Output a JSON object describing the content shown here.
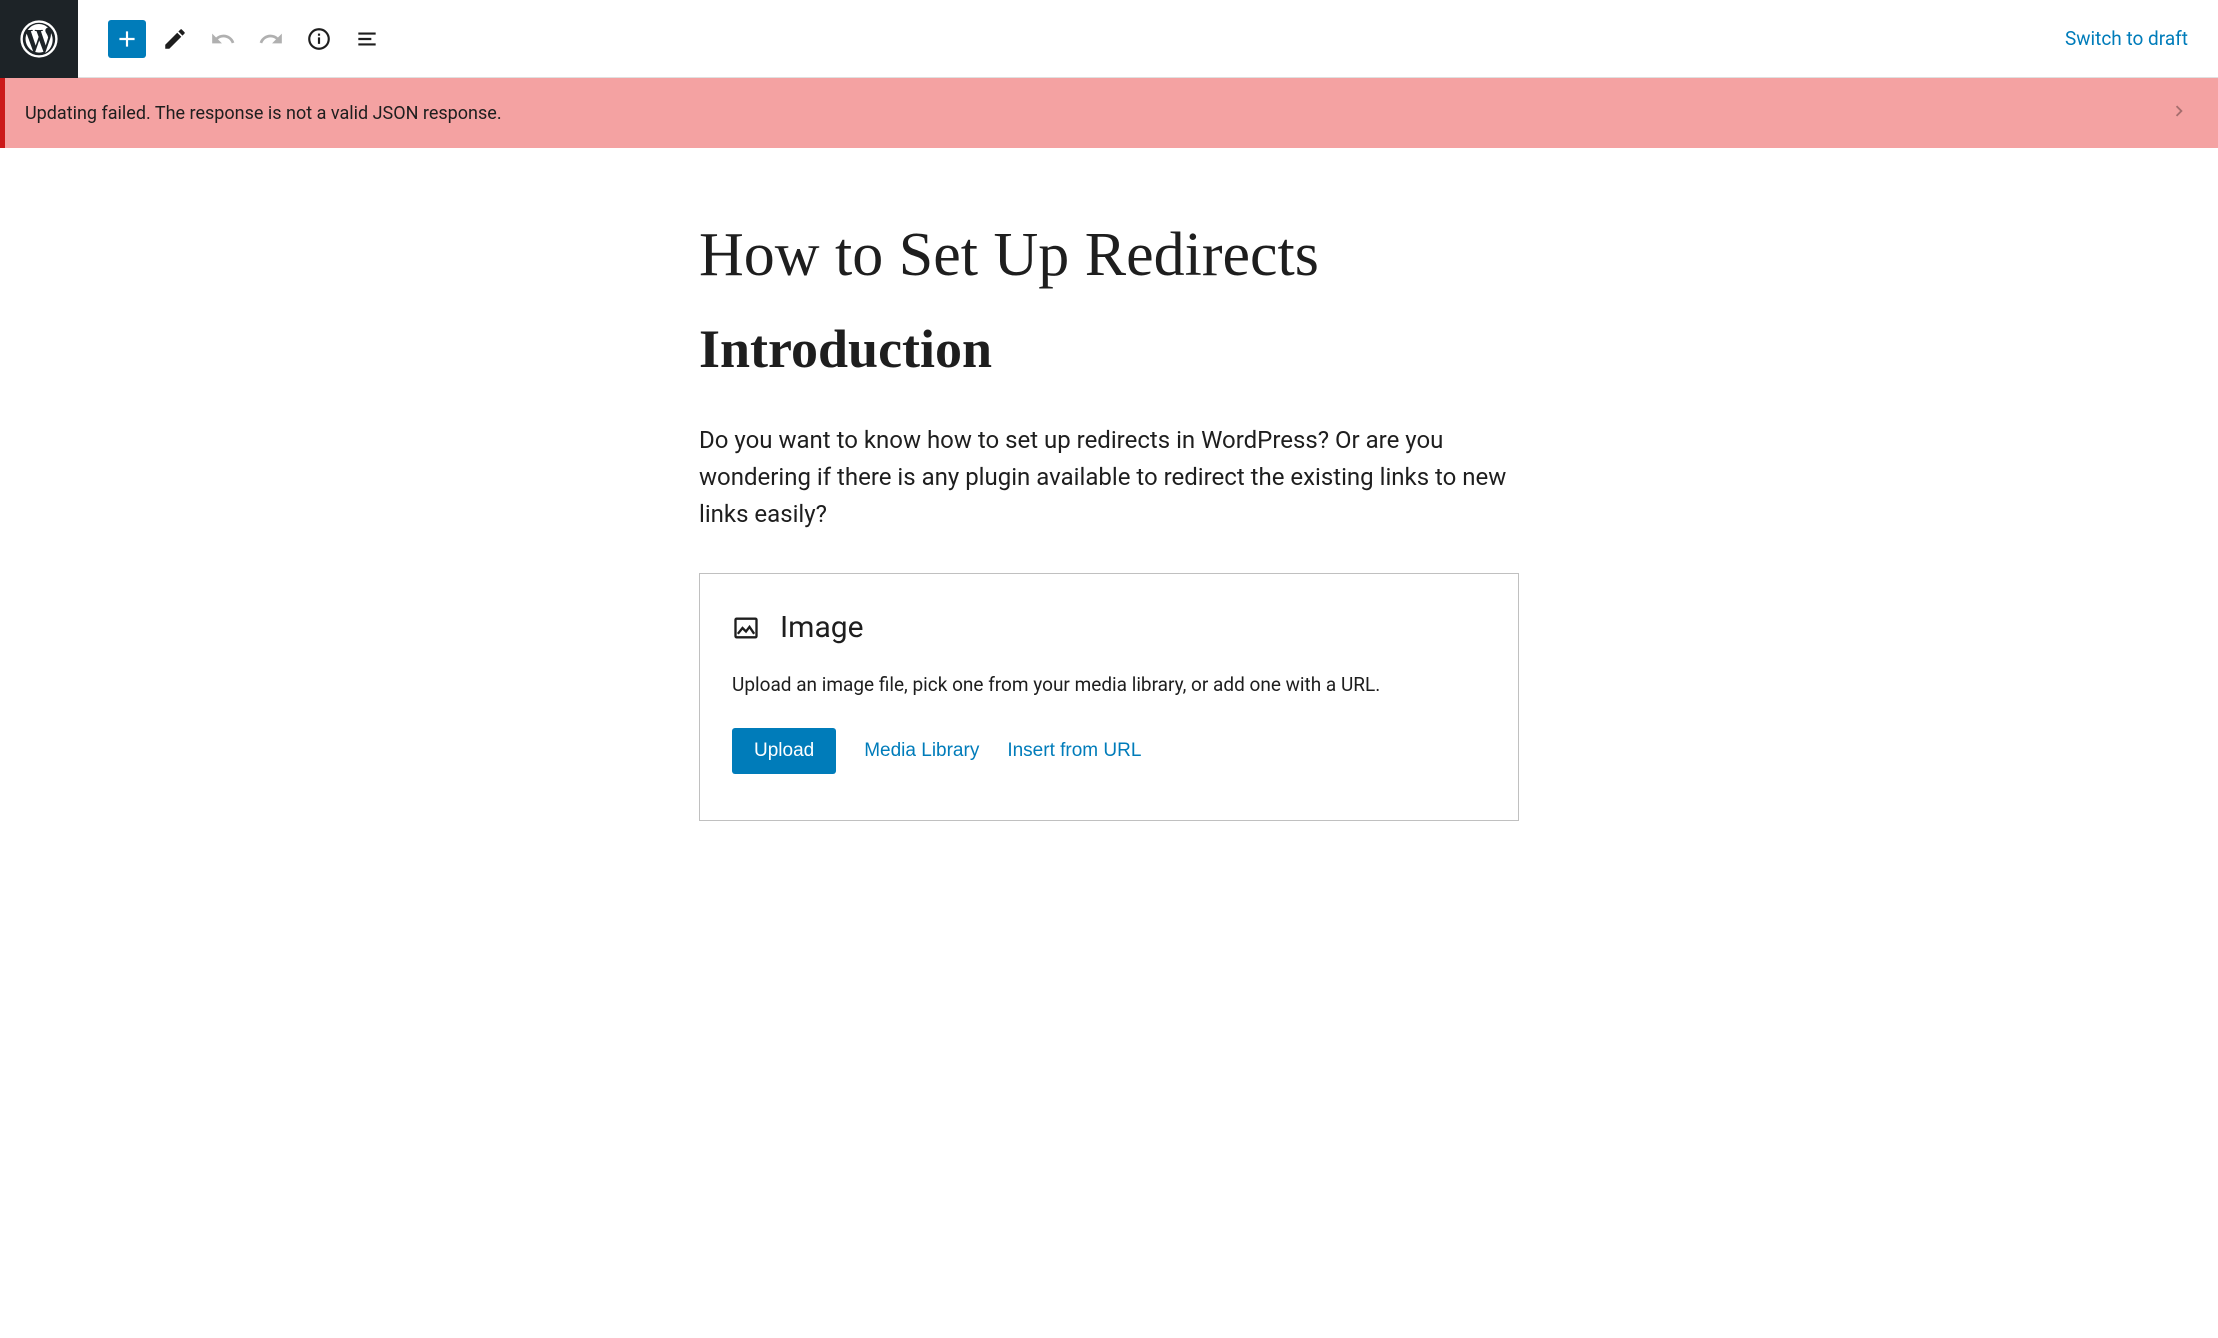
{
  "toolbar": {
    "switch_to_draft_label": "Switch to draft"
  },
  "error": {
    "message": "Updating failed. The response is not a valid JSON response."
  },
  "post": {
    "title": "How to Set Up Redirects",
    "heading": "Introduction",
    "paragraph": "Do you want to know how to set up redirects in WordPress?  Or are you wondering if there is any plugin available to redirect the existing links to new links easily?"
  },
  "image_block": {
    "title": "Image",
    "description": "Upload an image file, pick one from your media library, or add one with a URL.",
    "upload_label": "Upload",
    "media_library_label": "Media Library",
    "insert_url_label": "Insert from URL"
  }
}
